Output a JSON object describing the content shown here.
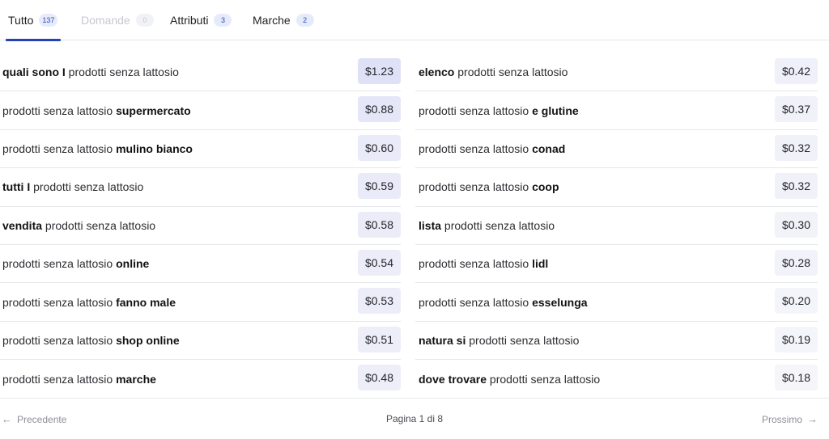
{
  "tabs": [
    {
      "label": "Tutto",
      "count": "137",
      "active": true,
      "disabled": false
    },
    {
      "label": "Domande",
      "count": "0",
      "active": false,
      "disabled": true
    },
    {
      "label": "Attributi",
      "count": "3",
      "active": false,
      "disabled": false
    },
    {
      "label": "Marche",
      "count": "2",
      "active": false,
      "disabled": false
    }
  ],
  "left_rows": [
    {
      "parts": [
        {
          "t": "quali sono I",
          "b": true
        },
        {
          "t": " prodotti senza lattosio",
          "b": false
        }
      ],
      "price": "$1.23",
      "color": "#dfe1f7"
    },
    {
      "parts": [
        {
          "t": "prodotti senza lattosio ",
          "b": false
        },
        {
          "t": "supermercato",
          "b": true
        }
      ],
      "price": "$0.88",
      "color": "#e5e7f8"
    },
    {
      "parts": [
        {
          "t": "prodotti senza lattosio ",
          "b": false
        },
        {
          "t": "mulino bianco",
          "b": true
        }
      ],
      "price": "$0.60",
      "color": "#eaebf8"
    },
    {
      "parts": [
        {
          "t": "tutti I",
          "b": true
        },
        {
          "t": " prodotti senza lattosio",
          "b": false
        }
      ],
      "price": "$0.59",
      "color": "#eaebf8"
    },
    {
      "parts": [
        {
          "t": "vendita",
          "b": true
        },
        {
          "t": " prodotti senza lattosio",
          "b": false
        }
      ],
      "price": "$0.58",
      "color": "#ebecf8"
    },
    {
      "parts": [
        {
          "t": "prodotti senza lattosio ",
          "b": false
        },
        {
          "t": "online",
          "b": true
        }
      ],
      "price": "$0.54",
      "color": "#ecedf8"
    },
    {
      "parts": [
        {
          "t": "prodotti senza lattosio ",
          "b": false
        },
        {
          "t": "fanno male",
          "b": true
        }
      ],
      "price": "$0.53",
      "color": "#ecedf8"
    },
    {
      "parts": [
        {
          "t": "prodotti senza lattosio ",
          "b": false
        },
        {
          "t": "shop online",
          "b": true
        }
      ],
      "price": "$0.51",
      "color": "#edeef8"
    },
    {
      "parts": [
        {
          "t": "prodotti senza lattosio ",
          "b": false
        },
        {
          "t": "marche",
          "b": true
        }
      ],
      "price": "$0.48",
      "color": "#edeef8"
    }
  ],
  "right_rows": [
    {
      "parts": [
        {
          "t": "elenco",
          "b": true
        },
        {
          "t": " prodotti senza lattosio",
          "b": false
        }
      ],
      "price": "$0.42",
      "color": "#eff0f9"
    },
    {
      "parts": [
        {
          "t": "prodotti senza lattosio ",
          "b": false
        },
        {
          "t": "e glutine",
          "b": true
        }
      ],
      "price": "$0.37",
      "color": "#f0f1f9"
    },
    {
      "parts": [
        {
          "t": "prodotti senza lattosio ",
          "b": false
        },
        {
          "t": "conad",
          "b": true
        }
      ],
      "price": "$0.32",
      "color": "#f1f2f9"
    },
    {
      "parts": [
        {
          "t": "prodotti senza lattosio ",
          "b": false
        },
        {
          "t": "coop",
          "b": true
        }
      ],
      "price": "$0.32",
      "color": "#f1f2f9"
    },
    {
      "parts": [
        {
          "t": "lista",
          "b": true
        },
        {
          "t": " prodotti senza lattosio",
          "b": false
        }
      ],
      "price": "$0.30",
      "color": "#f2f3f9"
    },
    {
      "parts": [
        {
          "t": "prodotti senza lattosio ",
          "b": false
        },
        {
          "t": "lidl",
          "b": true
        }
      ],
      "price": "$0.28",
      "color": "#f2f3fa"
    },
    {
      "parts": [
        {
          "t": "prodotti senza lattosio ",
          "b": false
        },
        {
          "t": "esselunga",
          "b": true
        }
      ],
      "price": "$0.20",
      "color": "#f4f5fa"
    },
    {
      "parts": [
        {
          "t": "natura si",
          "b": true
        },
        {
          "t": " prodotti senza lattosio",
          "b": false
        }
      ],
      "price": "$0.19",
      "color": "#f4f5fa"
    },
    {
      "parts": [
        {
          "t": "dove trovare",
          "b": true
        },
        {
          "t": " prodotti senza lattosio",
          "b": false
        }
      ],
      "price": "$0.18",
      "color": "#f5f5fa"
    }
  ],
  "pagination": {
    "prev_label": "Precedente",
    "page_label": "Pagina 1 di 8",
    "next_label": "Prossimo",
    "prev_icon": "arrow-left-icon",
    "next_icon": "arrow-right-icon"
  },
  "colors": {
    "accent": "#2640b7",
    "badge_bg": "#e5ebfb"
  }
}
